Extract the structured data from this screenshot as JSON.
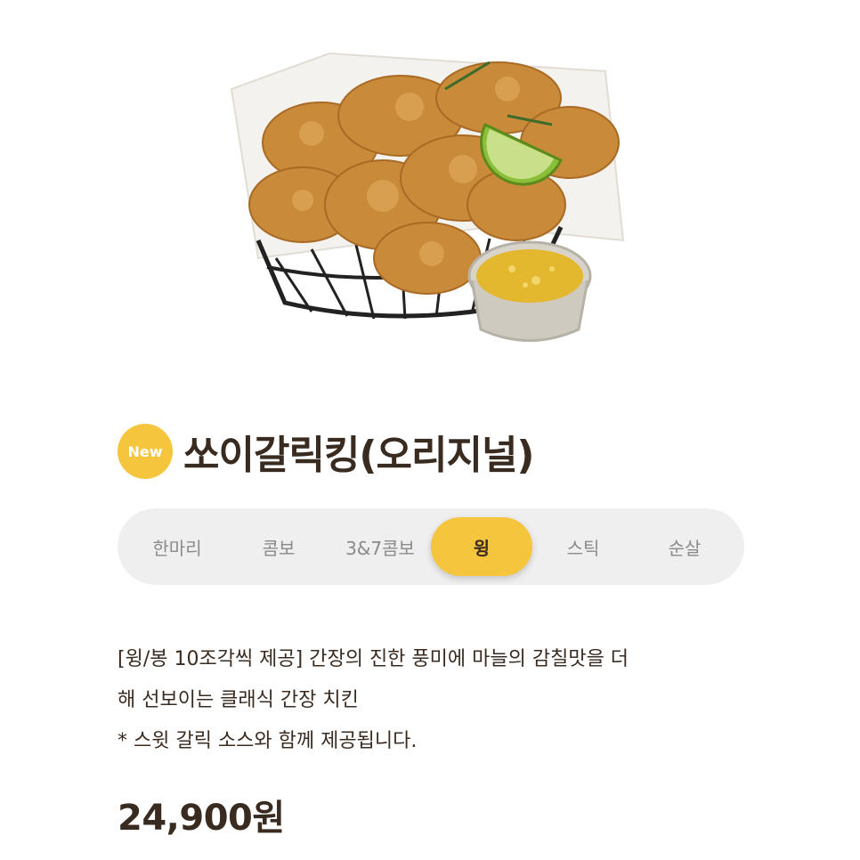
{
  "product": {
    "image_alt": "chicken-basket-photo",
    "badge": "New",
    "title": "쏘이갈릭킹(오리지널)",
    "price": "24,900원",
    "description": [
      "[윙/봉 10조각씩 제공] 간장의 진한 풍미에 마늘의 감칠맛을 더",
      "해 선보이는 클래식 간장 치킨",
      "* 스윗 갈릭 소스와 함께 제공됩니다."
    ]
  },
  "tabs": [
    {
      "label": "한마리",
      "active": false
    },
    {
      "label": "콤보",
      "active": false
    },
    {
      "label": "3&7콤보",
      "active": false
    },
    {
      "label": "윙",
      "active": true
    },
    {
      "label": "스틱",
      "active": false
    },
    {
      "label": "순살",
      "active": false
    }
  ],
  "colors": {
    "accent": "#f5c53e",
    "text": "#3a2b20",
    "tab_bg": "#efefef",
    "tab_inactive": "#8a8a8a"
  }
}
